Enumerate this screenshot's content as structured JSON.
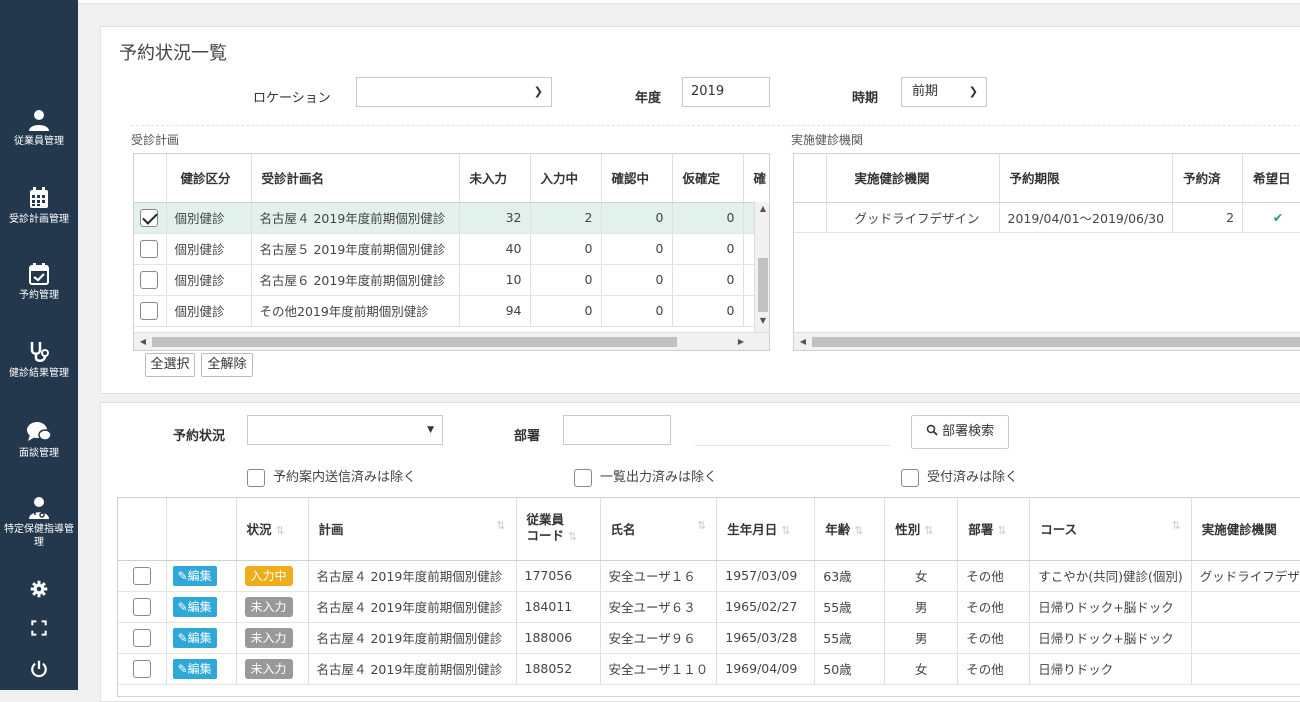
{
  "sidebar": {
    "items": [
      {
        "label": "従業員管理",
        "icon": "user-icon"
      },
      {
        "label": "受診計画管理",
        "icon": "calendar-grid-icon"
      },
      {
        "label": "予約管理",
        "icon": "calendar-check-icon"
      },
      {
        "label": "健診結果管理",
        "icon": "stethoscope-icon"
      },
      {
        "label": "面談管理",
        "icon": "chat-icon"
      },
      {
        "label": "特定保健指導管理",
        "icon": "doctor-icon"
      }
    ],
    "bottom_icons": [
      "gear-icon",
      "expand-icon",
      "power-icon"
    ]
  },
  "page": {
    "title": "予約状況一覧"
  },
  "filters": {
    "location_label": "ロケーション",
    "location_value": "",
    "year_label": "年度",
    "year_value": "2019",
    "period_label": "時期",
    "period_value": "前期"
  },
  "plan_section": {
    "title": "受診計画",
    "columns": [
      "健診区分",
      "受診計画名",
      "未入力",
      "入力中",
      "確認中",
      "仮確定",
      "確"
    ],
    "rows": [
      {
        "checked": true,
        "category": "個別健診",
        "name": "名古屋４ 2019年度前期個別健診",
        "v1": "32",
        "v2": "2",
        "v3": "0",
        "v4": "0"
      },
      {
        "checked": false,
        "category": "個別健診",
        "name": "名古屋５ 2019年度前期個別健診",
        "v1": "40",
        "v2": "0",
        "v3": "0",
        "v4": "0"
      },
      {
        "checked": false,
        "category": "個別健診",
        "name": "名古屋６ 2019年度前期個別健診",
        "v1": "10",
        "v2": "0",
        "v3": "0",
        "v4": "0"
      },
      {
        "checked": false,
        "category": "個別健診",
        "name": "その他2019年度前期個別健診",
        "v1": "94",
        "v2": "0",
        "v3": "0",
        "v4": "0"
      }
    ],
    "select_all": "全選択",
    "deselect_all": "全解除"
  },
  "institution_section": {
    "title": "実施健診機関",
    "columns": [
      "実施健診機関",
      "予約期限",
      "予約済",
      "希望日"
    ],
    "rows": [
      {
        "name": "グッドライフデザイン",
        "deadline": "2019/04/01～2019/06/30",
        "reserved": "2",
        "preferred": "✔"
      }
    ]
  },
  "search": {
    "status_label": "予約状況",
    "status_value": "",
    "dept_label": "部署",
    "dept_value": "",
    "dept_search_button": "部署検索",
    "exclude1": "予約案内送信済みは除く",
    "exclude2": "一覧出力済みは除く",
    "exclude3": "受付済みは除く"
  },
  "results": {
    "columns": [
      "状況",
      "計画",
      "従業員\nコード",
      "氏名",
      "生年月日",
      "年齢",
      "性別",
      "部署",
      "コース",
      "実施健診機関"
    ],
    "edit_label": "編集",
    "rows": [
      {
        "status": "入力中",
        "status_type": "in",
        "plan": "名古屋４ 2019年度前期個別健診",
        "code": "177056",
        "name": "安全ユーザ１６",
        "dob": "1957/03/09",
        "age": "63歳",
        "sex": "女",
        "dept": "その他",
        "course": "すこやか(共同)健診(個別)",
        "inst": "グッドライフデザ"
      },
      {
        "status": "未入力",
        "status_type": "no",
        "plan": "名古屋４ 2019年度前期個別健診",
        "code": "184011",
        "name": "安全ユーザ６３",
        "dob": "1965/02/27",
        "age": "55歳",
        "sex": "男",
        "dept": "その他",
        "course": "日帰りドック+脳ドック",
        "inst": ""
      },
      {
        "status": "未入力",
        "status_type": "no",
        "plan": "名古屋４ 2019年度前期個別健診",
        "code": "188006",
        "name": "安全ユーザ９６",
        "dob": "1965/03/28",
        "age": "55歳",
        "sex": "男",
        "dept": "その他",
        "course": "日帰りドック+脳ドック",
        "inst": ""
      },
      {
        "status": "未入力",
        "status_type": "no",
        "plan": "名古屋４ 2019年度前期個別健診",
        "code": "188052",
        "name": "安全ユーザ１１０",
        "dob": "1969/04/09",
        "age": "50歳",
        "sex": "女",
        "dept": "その他",
        "course": "日帰りドック",
        "inst": ""
      }
    ]
  },
  "colors": {
    "sidebar": "#23384d",
    "selected_row": "#e2f1ec",
    "edit_button": "#2fa8d8",
    "status_in": "#f0ad1b",
    "status_no": "#999999",
    "check": "#2a9d6b"
  }
}
